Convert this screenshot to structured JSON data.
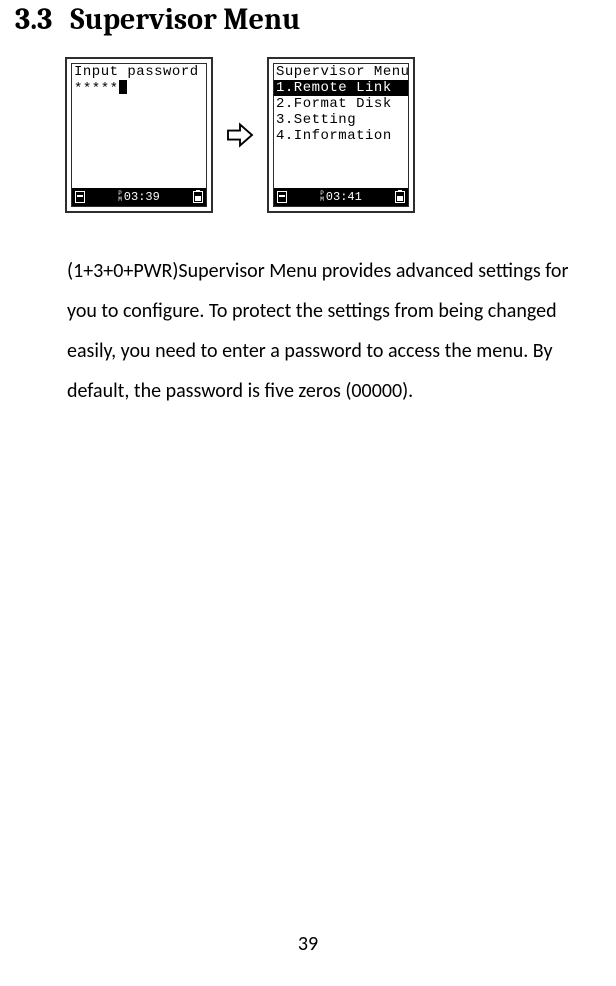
{
  "section": {
    "number": "3.3",
    "title": "Supervisor Menu"
  },
  "screens": {
    "password": {
      "line1": "Input password",
      "masked": "*****",
      "time": "03:39",
      "ampm_top": "P",
      "ampm_bot": "M"
    },
    "menu": {
      "title": "Supervisor Menu",
      "items": [
        {
          "idx": "1",
          "label": "Remote Link",
          "selected": true
        },
        {
          "idx": "2",
          "label": "Format Disk",
          "selected": false
        },
        {
          "idx": "3",
          "label": "Setting",
          "selected": false
        },
        {
          "idx": "4",
          "label": "Information",
          "selected": false
        }
      ],
      "time": "03:41",
      "ampm_top": "P",
      "ampm_bot": "M"
    }
  },
  "paragraph": "(1+3+0+PWR)Supervisor Menu provides advanced settings for you to configure. To protect the settings from being changed easily, you need to enter a password to access the menu. By default, the password is five zeros (00000).",
  "page_number": "39"
}
